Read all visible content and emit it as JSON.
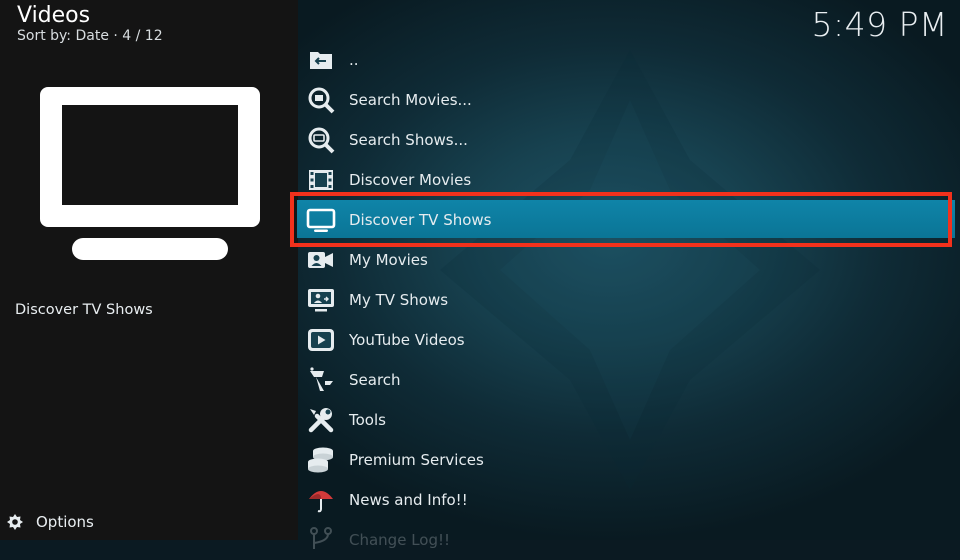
{
  "header": {
    "title": "Videos",
    "subtitle": "Sort by: Date  ·  4 / 12",
    "clock": "5:49 PM"
  },
  "preview": {
    "icon": "tv-icon",
    "label": "Discover TV Shows"
  },
  "footer": {
    "options_label": "Options",
    "options_icon": "options-gear-icon"
  },
  "colors": {
    "focus": "#0b7ea2",
    "highlight": "#f2311c"
  },
  "menu": {
    "items": [
      {
        "label": "..",
        "icon": "back-folder-icon"
      },
      {
        "label": "Search Movies...",
        "icon": "search-movies-icon"
      },
      {
        "label": "Search Shows...",
        "icon": "search-shows-icon"
      },
      {
        "label": "Discover Movies",
        "icon": "film-strip-icon"
      },
      {
        "label": "Discover TV Shows",
        "icon": "tv-icon",
        "focused": true
      },
      {
        "label": "My Movies",
        "icon": "camera-user-icon"
      },
      {
        "label": "My TV Shows",
        "icon": "tv-user-icon"
      },
      {
        "label": "YouTube Videos",
        "icon": "youtube-icon"
      },
      {
        "label": "Search",
        "icon": "antenna-icon"
      },
      {
        "label": "Tools",
        "icon": "tools-icon"
      },
      {
        "label": "Premium Services",
        "icon": "coins-icon"
      },
      {
        "label": "News and Info!!",
        "icon": "umbrella-icon"
      },
      {
        "label": "Change Log!!",
        "icon": "branch-icon"
      }
    ]
  }
}
